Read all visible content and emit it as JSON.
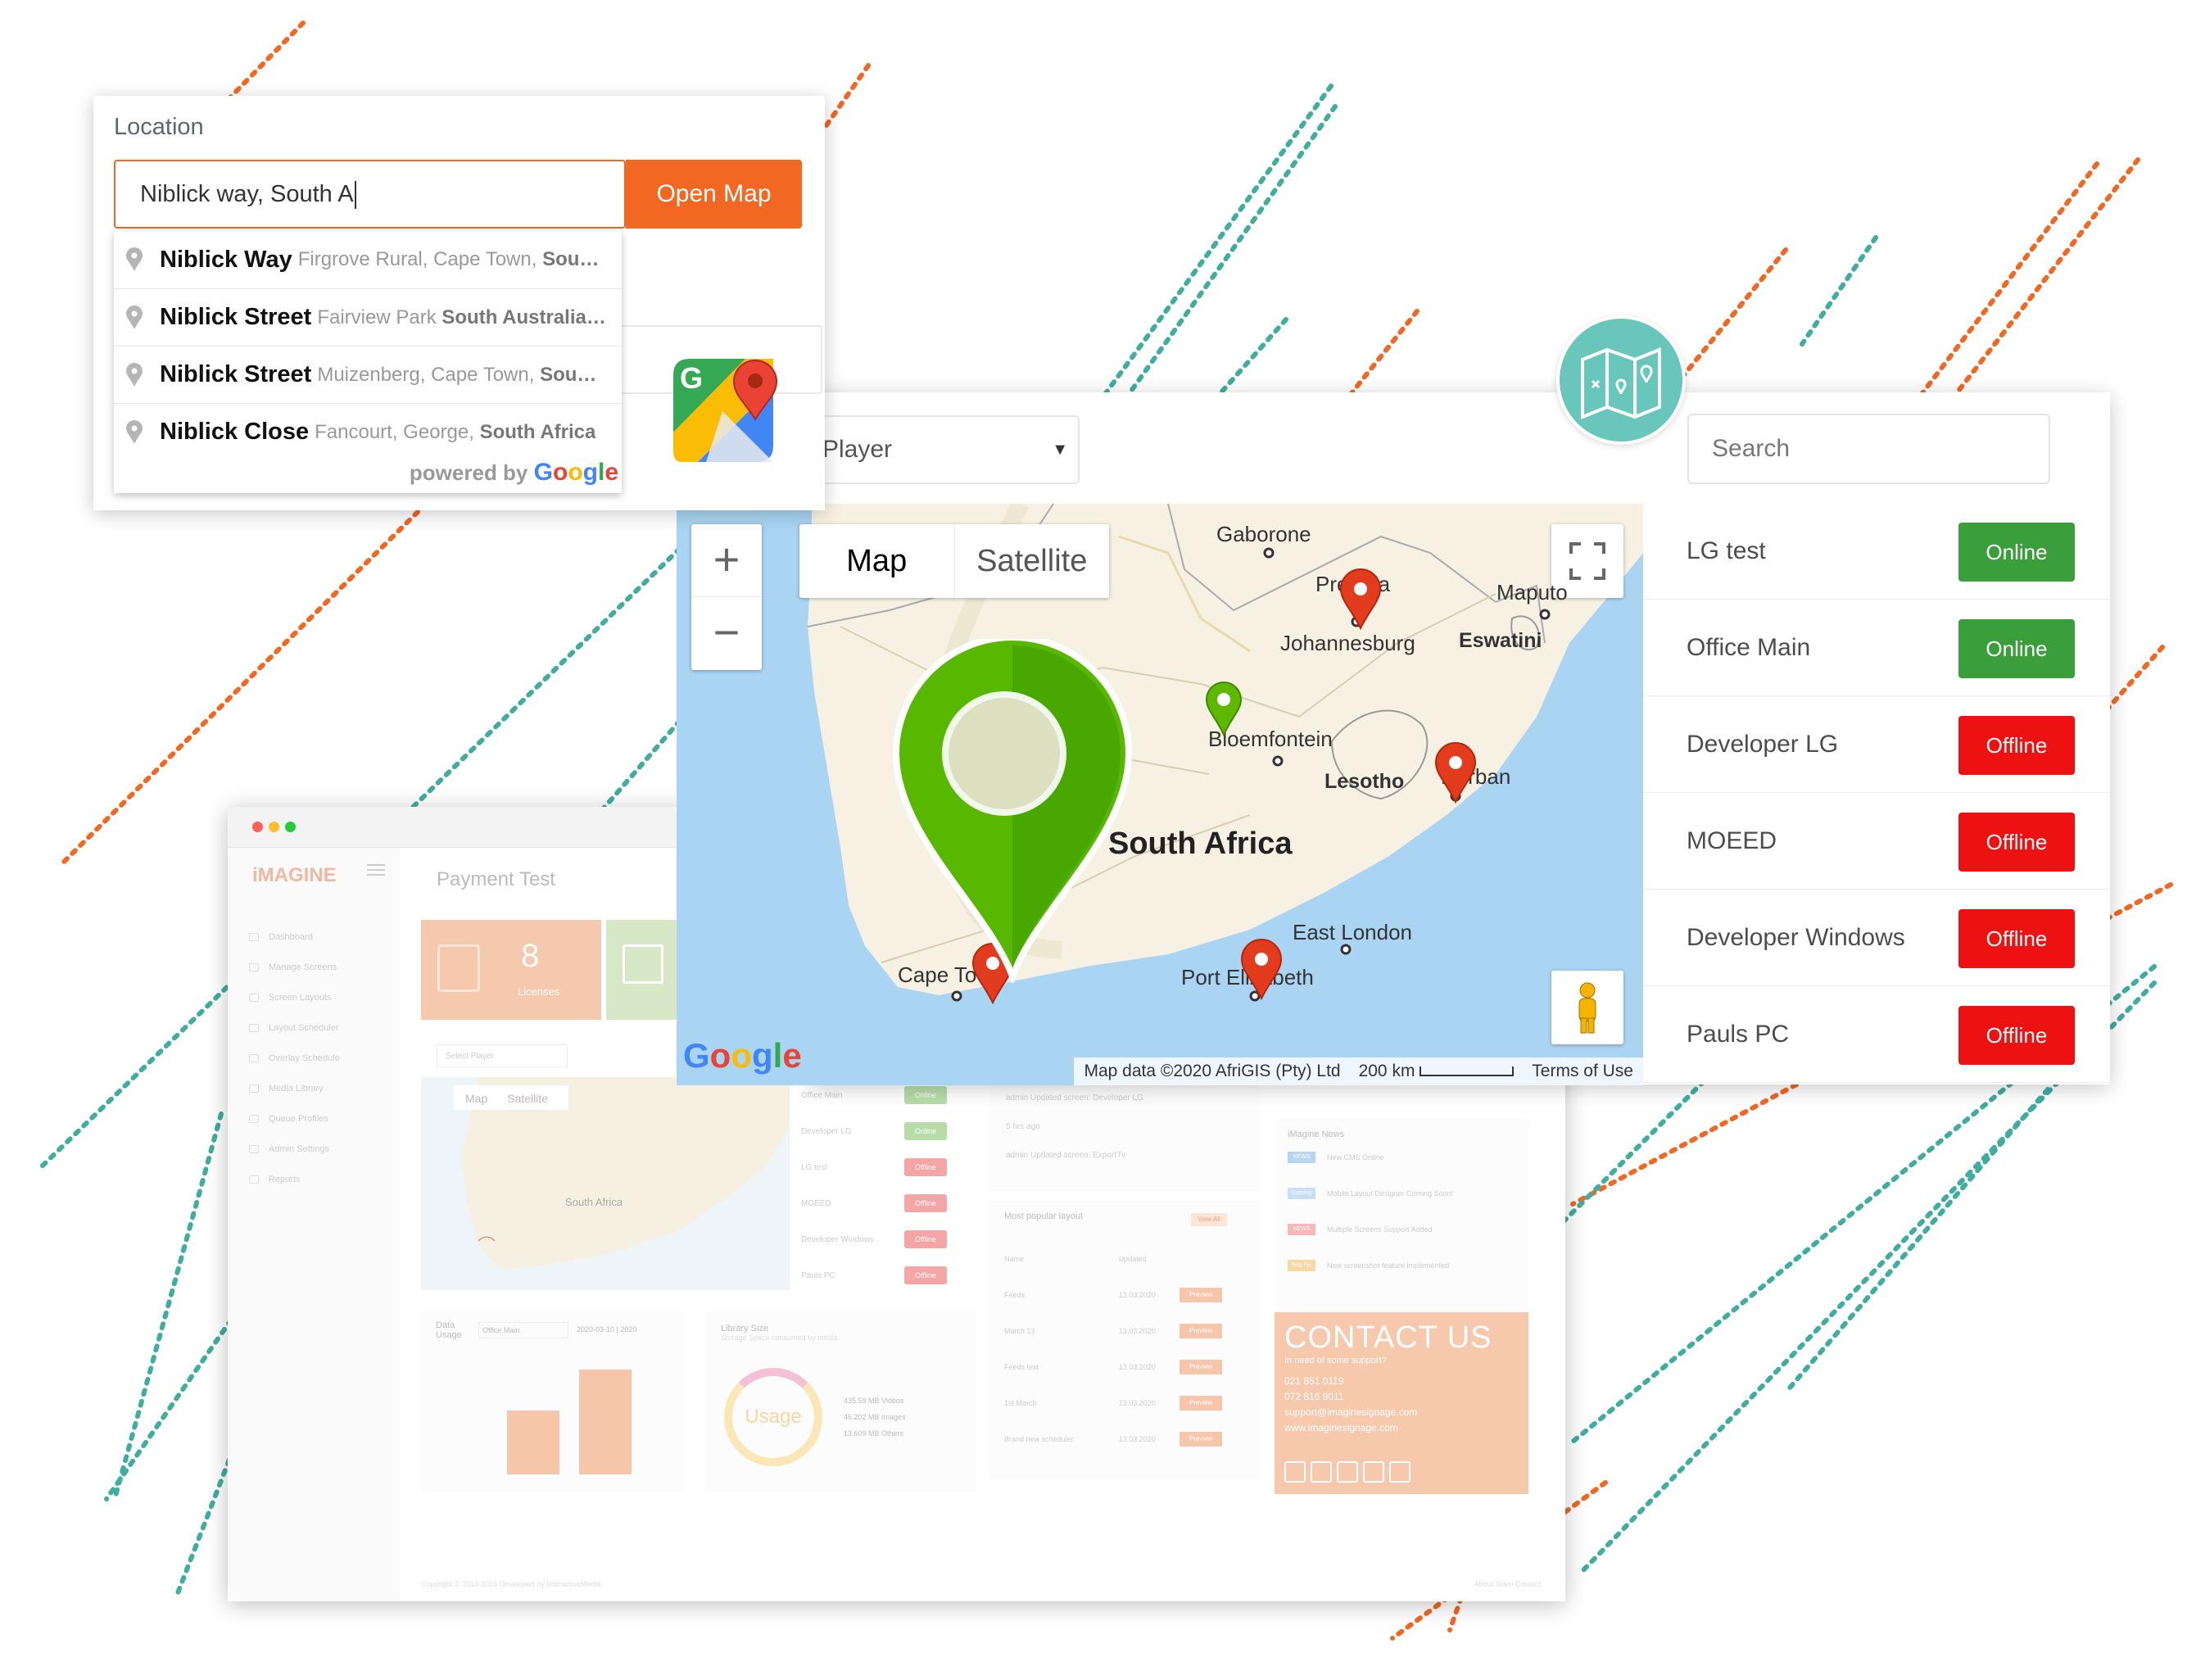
{
  "location_card": {
    "label": "Location",
    "input_value": "Niblick way, South A",
    "open_map_label": "Open Map",
    "suggestions": [
      {
        "main": "Niblick Way",
        "secondary": "Firgrove Rural, Cape Town, ",
        "secondary_bold": "Sou…"
      },
      {
        "main": "Niblick Street",
        "secondary": "Fairview Park ",
        "secondary_bold": "South Australia…"
      },
      {
        "main": "Niblick Street",
        "secondary": "Muizenberg, Cape Town, ",
        "secondary_bold": "Sou…"
      },
      {
        "main": "Niblick Close",
        "secondary": "Fancourt, George, ",
        "secondary_bold": "South Africa"
      }
    ],
    "powered_by": "powered by",
    "powered_google": "Google"
  },
  "player_panel": {
    "player_select": "Player",
    "search_placeholder": "Search",
    "players": [
      {
        "name": "LG test",
        "status": "Online"
      },
      {
        "name": "Office Main",
        "status": "Online"
      },
      {
        "name": "Developer LG",
        "status": "Offline"
      },
      {
        "name": "MOEED",
        "status": "Offline"
      },
      {
        "name": "Developer Windows",
        "status": "Offline"
      },
      {
        "name": "Pauls PC",
        "status": "Offline"
      }
    ],
    "status_colors": {
      "Online": "#3a9e3a",
      "Offline": "#ee1111"
    }
  },
  "map": {
    "zoom_in": "+",
    "zoom_out": "−",
    "type_map": "Map",
    "type_satellite": "Satellite",
    "cities": {
      "gaborone": "Gaborone",
      "pretoria": "Pretoria",
      "maputo": "Maputo",
      "johannesburg": "Johannesburg",
      "eswatini": "Eswatini",
      "bloemfontein": "Bloemfontein",
      "lesotho": "Lesotho",
      "durban": "Durban",
      "country": "South Africa",
      "east_london": "East London",
      "port_elizabeth": "Port Elizabeth",
      "cape_town": "Cape Town"
    },
    "google_logo": "Google",
    "attribution": "Map data ©2020 AfriGIS (Pty) Ltd",
    "scale": "200 km",
    "terms": "Terms of Use"
  },
  "dashboard": {
    "logo": "iMAGINE",
    "page_title": "Payment Test",
    "licenses_count": "8",
    "licenses_label": "Licenses",
    "nav": [
      "Dashboard",
      "Manage Screens",
      "Screen Layouts",
      "Layout Scheduler",
      "Overlay Schedule",
      "Media Library",
      "Queue Profiles",
      "Admin Settings",
      "Reports"
    ],
    "select_player": "Select Player",
    "mini_map_tabs": [
      "Map",
      "Satellite"
    ],
    "mini_map_country": "South Africa",
    "mini_players": [
      {
        "name": "Office Main",
        "status": "Online"
      },
      {
        "name": "Developer LG",
        "status": "Online"
      },
      {
        "name": "LG test",
        "status": "Offline"
      },
      {
        "name": "MOEED",
        "status": "Offline"
      },
      {
        "name": "Developer Windows",
        "status": "Offline"
      },
      {
        "name": "Pauls PC",
        "status": "Offline"
      }
    ],
    "feed": [
      "admin Updated screen: Developer LG",
      "5 hrs ago",
      "admin Updated screen: ExportTv"
    ],
    "popular_title": "Most popular layout",
    "view_all": "View All",
    "popular_headers": [
      "Name",
      "Updated"
    ],
    "popular_rows": [
      {
        "name": "Feeds",
        "updated": "13.03.2020"
      },
      {
        "name": "March 13",
        "updated": "13.03.2020"
      },
      {
        "name": "Feeds test",
        "updated": "13.03.2020"
      },
      {
        "name": "1st March",
        "updated": "13.03.2020"
      },
      {
        "name": "Brand new scheduler",
        "updated": "13.03.2020"
      }
    ],
    "preview_label": "Preview",
    "news_title": "iMagine News",
    "news": [
      {
        "tag": "NEWS",
        "text": "New CMS Online"
      },
      {
        "tag": "Coming Soon!",
        "text": "Mobile Layout Designer Coming Soon!"
      },
      {
        "tag": "NEWS",
        "text": "Multiple Screens Support Added"
      },
      {
        "tag": "Bug Fix",
        "text": "New screenshot feature implemented"
      }
    ],
    "contact_title": "CONTACT US",
    "contact_sub": "In need of some support?",
    "contact_lines": [
      "021 851 0119",
      "072 816 9011",
      "support@imaginesignage.com",
      "www.imaginesignage.com"
    ],
    "data_usage_title": "Data Usage",
    "data_usage_select": "Office Main",
    "data_usage_date": "2020-03-10 | 2020",
    "library_title": "Library Size",
    "library_sub": "Storage Space consumed by media",
    "library_center": "Usage",
    "library_legend": [
      "435.59 MB Videos",
      "46.202 MB Images",
      "13.609 MB Others"
    ],
    "footer_left": "Copyright © 2014-2019 Developed by InteractiveMedia",
    "footer_right": "About   Team   Contact"
  }
}
